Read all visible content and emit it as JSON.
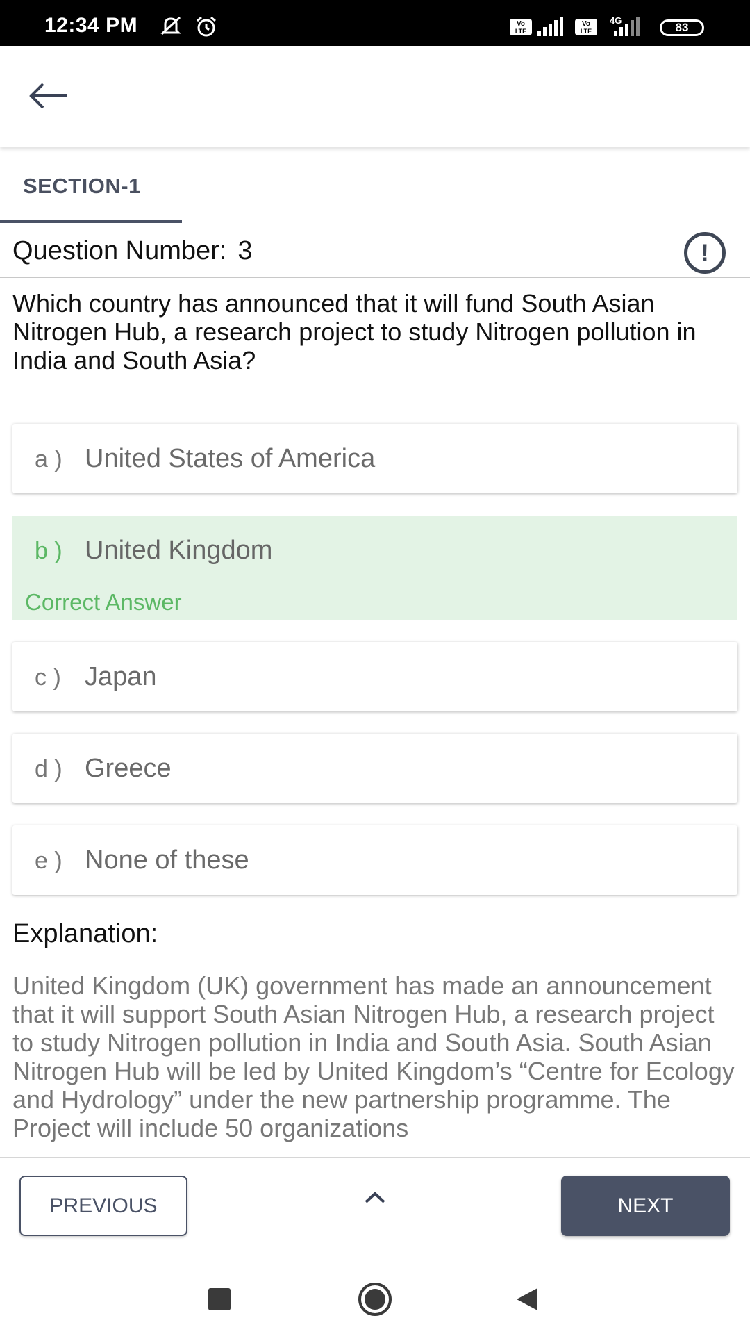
{
  "status_bar": {
    "time": "12:34 PM",
    "battery": "83",
    "network_label": "4G",
    "sim_label": "Vo LTE",
    "icons": [
      "mute-icon",
      "alarm-icon",
      "volte-icon",
      "signal-icon",
      "battery-icon"
    ]
  },
  "app_bar": {
    "back_icon": "arrow-left-icon"
  },
  "section": {
    "tab_label": "SECTION-1"
  },
  "question": {
    "number_label": "Question Number:",
    "number": "3",
    "report_icon": "exclamation-circle-icon",
    "text": "Which country has announced that it will fund South Asian Nitrogen Hub, a research project to study Nitrogen pollution in India and South Asia?"
  },
  "options": [
    {
      "letter": "a )",
      "text": "United States of America"
    },
    {
      "letter": "b )",
      "text": "United Kingdom",
      "status": "Correct Answer"
    },
    {
      "letter": "c )",
      "text": "Japan"
    },
    {
      "letter": "d )",
      "text": "Greece"
    },
    {
      "letter": "e )",
      "text": "None of these"
    }
  ],
  "explanation": {
    "title": "Explanation:",
    "text": "United Kingdom (UK) government has made an announcement that it will support South Asian Nitrogen Hub, a research project to study Nitrogen pollution in India and South Asia. South Asian Nitrogen Hub will be led by United Kingdom’s “Centre for Ecology and Hydrology” under the new partnership programme. The Project will include 50 organizations"
  },
  "navigation": {
    "previous_label": "PREVIOUS",
    "next_label": "NEXT",
    "up_icon": "chevron-up-icon"
  },
  "colors": {
    "accent": "#4a5266",
    "correct_green": "#5cb865",
    "correct_bg": "#e3f3e5"
  }
}
